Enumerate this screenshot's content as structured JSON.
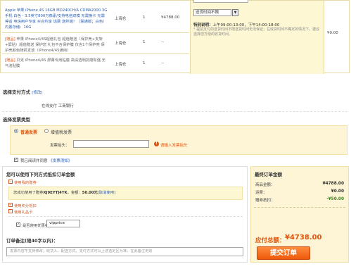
{
  "items": [
    {
      "tag": "",
      "name": "Apple 苹果 iPhone 4S 16GB MD240CH/A CDMA2000 3G手机 白色 - 3.5英寸800万像素/支持电信双模 无需换卡 无需停话 电信用户专享 买合约享 话费 送终端！（联通版；白色）内置存储：16G",
      "location": "上海仓",
      "qty": "1",
      "price": "¥4788.00"
    },
    {
      "tag": "[赠品]",
      "name": "苹果 iPhone4/4S超值礼包 超值赠送（保护壳+支架+屏贴）超值赠送 保护您 礼包不含保护膜 仅含1个保护壳 保护壳颜色随机发放（iPhone4/4S通用）",
      "location": "上海仓",
      "qty": "1",
      "price": "--"
    },
    {
      "tag": "[赠品]",
      "name": "贝克 iPhone4/4S 屏幕专用贴膜 高清透明抗磨有强 无气泡贴膜",
      "location": "上海仓",
      "qty": "1",
      "price": "--"
    }
  ],
  "delivery": {
    "time_select": "送货时间不限",
    "special_label": "特别说明：",
    "special_text": "上午09:00-13:00，下午14:00-18:00",
    "tip": "* 提前支付的送货时间不限送货时间无法保证；在收货时间不确定的情况下，建议选择您方便的收货时间。"
  },
  "subtotal": "¥0.00",
  "payment": {
    "title": "选择支付方式",
    "edit": "[修改]",
    "method": "在线支付  工商银行"
  },
  "invoice": {
    "title": "选择发票类型",
    "option_plain": "普通发票",
    "option_vat": "增值税发票",
    "header_label": "发票抬头：",
    "header_value": "",
    "warn": "请输入发票抬头",
    "agree": "我已阅读并同意",
    "agree_link": "《发票须知》"
  },
  "discounts": {
    "title": "您可以使用下列方式抵扣订单金额",
    "gift_label": "使用我的赠券",
    "gift_text_pre": "您成功使用了赠券",
    "gift_code": "XJ9EYTJ4TK",
    "gift_mid": "，金额：",
    "gift_amount": "50.00元",
    "gift_cancel": "[取消使用]",
    "points_label": "使用积分抵扣",
    "coupon_label": "使用礼品卡",
    "coupon_check_label": "是否使用优惠券",
    "coupon_value": "vipprice",
    "note_title": "订单备注(限40字以内)：",
    "note_placeholder": "发票内容不支持修改；收货人、配送方式、支付方式可以上述选定区为准，在此备注无效"
  },
  "summary": {
    "title": "最终订单金额",
    "total_label": "商品金额：",
    "total_value": "¥4788.00",
    "ship_label": "运费：",
    "ship_value": "¥0.00",
    "disc_label": "赠券抵扣：",
    "disc_value": "-¥50.00",
    "pay_label": "应付总额：",
    "pay_value": "¥4738.00",
    "submit": "提交订单"
  }
}
